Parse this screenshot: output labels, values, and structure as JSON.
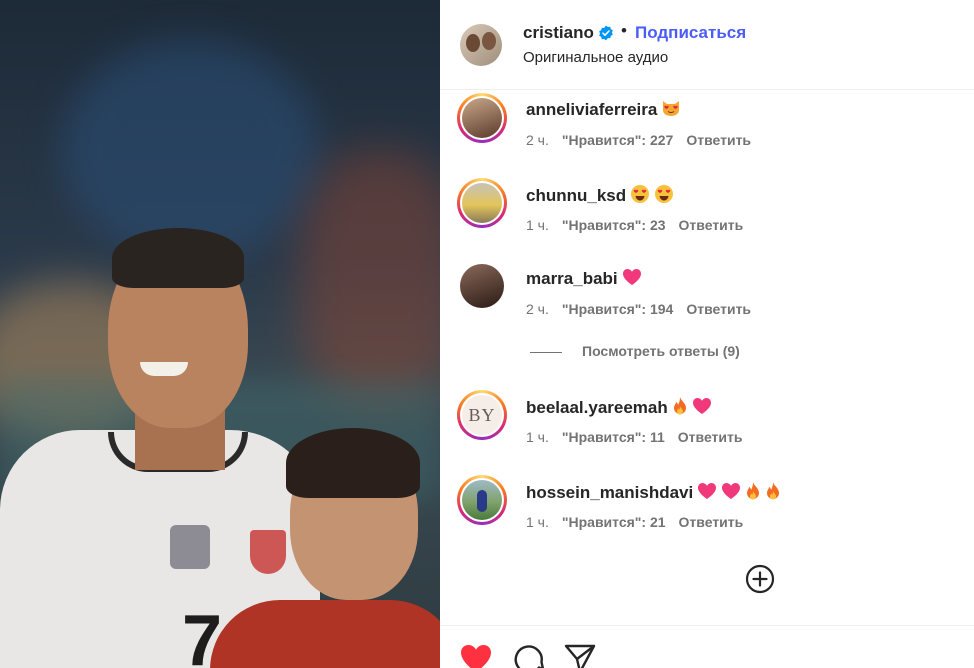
{
  "post": {
    "author": "cristiano",
    "follow_label": "Подписаться",
    "separator": "•",
    "audio": "Оригинальное аудио"
  },
  "comments": [
    {
      "username": "anneliviaferreira",
      "emojis": [
        "cat-heart-eyes"
      ],
      "time": "2 ч.",
      "likes": "\"Нравится\": 227",
      "reply": "Ответить",
      "ring": true
    },
    {
      "username": "chunnu_ksd",
      "emojis": [
        "heart-eyes",
        "heart-eyes"
      ],
      "time": "1 ч.",
      "likes": "\"Нравится\": 23",
      "reply": "Ответить",
      "ring": true
    },
    {
      "username": "marra_babi",
      "emojis": [
        "pink-heart"
      ],
      "time": "2 ч.",
      "likes": "\"Нравится\": 194",
      "reply": "Ответить",
      "ring": false
    },
    {
      "username": "beelaal.yareemah",
      "emojis": [
        "fire",
        "pink-heart"
      ],
      "time": "1 ч.",
      "likes": "\"Нравится\": 11",
      "reply": "Ответить",
      "ring": true,
      "avatar_text": "BY"
    },
    {
      "username": "hossein_manishdavi",
      "emojis": [
        "pink-heart",
        "pink-heart",
        "fire",
        "fire"
      ],
      "time": "1 ч.",
      "likes": "\"Нравится\": 21",
      "reply": "Ответить",
      "ring": true
    }
  ],
  "view_replies": "Посмотреть ответы (9)",
  "colors": {
    "accent": "#4a5df9",
    "like_red": "#ff3040",
    "muted": "#737373",
    "text": "#262626"
  },
  "icons": {
    "verified": "verified-badge-icon",
    "add": "plus-circle-icon",
    "like": "heart-filled-icon",
    "comment": "comment-bubble-icon",
    "share": "paper-plane-icon"
  }
}
